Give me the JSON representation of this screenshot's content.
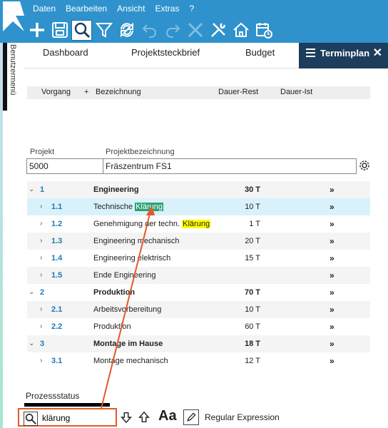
{
  "menu": [
    "Daten",
    "Bearbeiten",
    "Ansicht",
    "Extras",
    "?"
  ],
  "tabs": {
    "dashboard": "Dashboard",
    "steckbrief": "Projektsteckbrief",
    "budget": "Budget",
    "terminplan": "Terminplan"
  },
  "sidebar_label": "Benutzermenü",
  "columns": {
    "vorgang": "Vorgang",
    "plus": "+",
    "bezeichnung": "Bezeichnung",
    "dauer_rest": "Dauer-Rest",
    "dauer_ist": "Dauer-Ist"
  },
  "project": {
    "label_projekt": "Projekt",
    "label_bezeichnung": "Projektbezeichnung",
    "nummer": "5000",
    "bezeichnung": "Fräszentrum FS1"
  },
  "rows": [
    {
      "num": "1",
      "desc": "Engineering",
      "dur": "30 T",
      "go": "»"
    },
    {
      "num": "1.1",
      "desc_pre": "Technische ",
      "desc_match": "Klärung",
      "desc_post": "",
      "dur": "10 T",
      "go": "»"
    },
    {
      "num": "1.2",
      "desc_pre": "Genehmigung der techn. ",
      "desc_match": "Klärung",
      "desc_post": "",
      "dur": "1 T",
      "go": "»"
    },
    {
      "num": "1.3",
      "desc": "Engineering mechanisch",
      "dur": "20 T",
      "go": "»"
    },
    {
      "num": "1.4",
      "desc": "Engineering elektrisch",
      "dur": "15 T",
      "go": "»"
    },
    {
      "num": "1.5",
      "desc": "Ende Engineering",
      "dur": "",
      "go": "»"
    },
    {
      "num": "2",
      "desc": "Produktion",
      "dur": "70 T",
      "go": "»"
    },
    {
      "num": "2.1",
      "desc": "Arbeitsvorbereitung",
      "dur": "10 T",
      "go": "»"
    },
    {
      "num": "2.2",
      "desc": "Produktion",
      "dur": "60 T",
      "go": "»"
    },
    {
      "num": "3",
      "desc": "Montage im Hause",
      "dur": "18 T",
      "go": "»"
    },
    {
      "num": "3.1",
      "desc": "Montage mechanisch",
      "dur": "12 T",
      "go": "»"
    }
  ],
  "footer": {
    "prozessstatus": "Prozessstatus"
  },
  "find": {
    "value": "klärung",
    "aa": "Aa",
    "regex": "Regular Expression"
  },
  "colors": {
    "accent": "#2f92cc",
    "tab_active": "#1d3d5c",
    "highlight_current": "#2aa174",
    "highlight_other": "#ffff00",
    "callout": "#e05a2b"
  }
}
